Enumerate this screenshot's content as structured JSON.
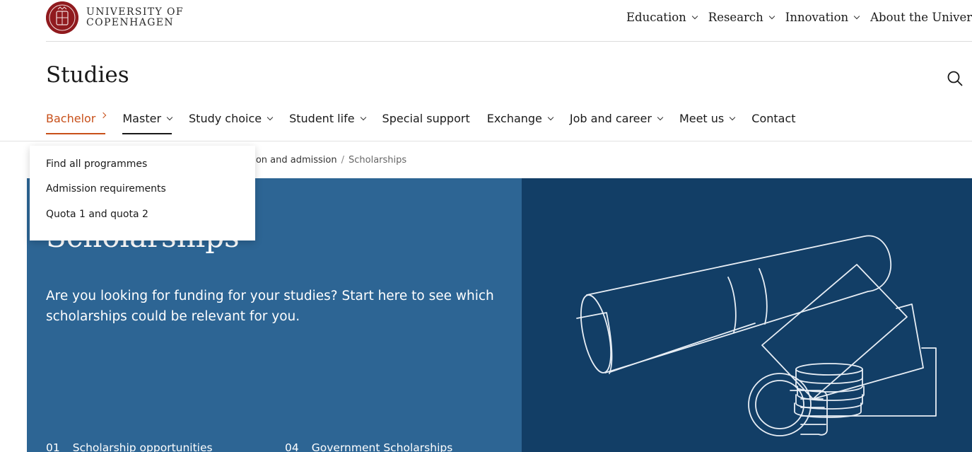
{
  "header": {
    "logo_line1": "UNIVERSITY OF",
    "logo_line2": "COPENHAGEN",
    "nav": [
      {
        "label": "Education"
      },
      {
        "label": "Research"
      },
      {
        "label": "Innovation"
      },
      {
        "label": "About the Universit"
      }
    ]
  },
  "section": {
    "title": "Studies"
  },
  "subnav": {
    "items": [
      {
        "label": "Bachelor"
      },
      {
        "label": "Master"
      },
      {
        "label": "Study choice"
      },
      {
        "label": "Student life"
      },
      {
        "label": "Special support"
      },
      {
        "label": "Exchange"
      },
      {
        "label": "Job and career"
      },
      {
        "label": "Meet us"
      },
      {
        "label": "Contact"
      }
    ]
  },
  "dropdown": {
    "items": [
      {
        "label": "Find all programmes"
      },
      {
        "label": "Admission requirements"
      },
      {
        "label": "Quota 1 and quota 2"
      }
    ]
  },
  "breadcrumb": {
    "parent": "cation and admission",
    "separator": "/",
    "current": "Scholarships"
  },
  "hero": {
    "title": "Scholarships",
    "lead": "Are you looking for funding for your studies? Start here to see which scholarships could be relevant for you.",
    "toc": [
      {
        "num": "01",
        "label": "Scholarship opportunities"
      },
      {
        "num": "04",
        "label": "Government Scholarships"
      }
    ]
  },
  "colors": {
    "accent": "#c8501a",
    "hero_left": "#2d6594",
    "hero_right": "#123e66",
    "seal": "#901a1e"
  },
  "icons": {
    "seal": "university-seal-icon",
    "search": "search-icon",
    "chevron": "chevron-down-icon",
    "chevron_right": "chevron-right-icon",
    "illustration": "diploma-and-coins-illustration"
  }
}
